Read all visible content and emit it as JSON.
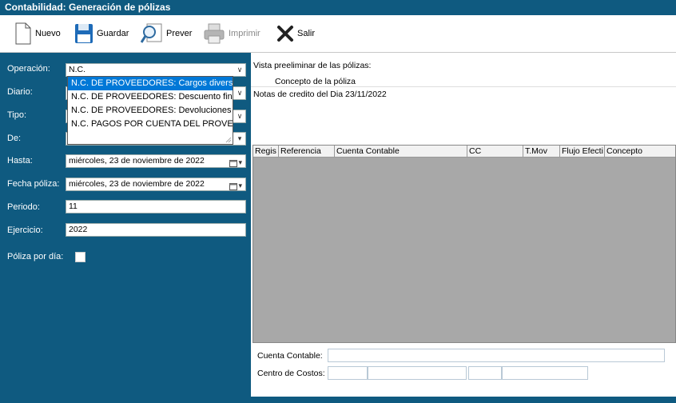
{
  "window": {
    "title": "Contabilidad: Generación de pólizas"
  },
  "toolbar": {
    "nuevo": "Nuevo",
    "guardar": "Guardar",
    "prever": "Prever",
    "imprimir": "Imprimir",
    "salir": "Salir"
  },
  "form": {
    "operacion_label": "Operación:",
    "operacion_value": "N.C.",
    "diario_label": "Diario:",
    "tipo_label": "Tipo:",
    "de_label": "De:",
    "hasta_label": "Hasta:",
    "hasta_value": "miércoles, 23 de noviembre de 2022",
    "fecha_label": "Fecha póliza:",
    "fecha_value": "miércoles, 23 de noviembre de 2022",
    "periodo_label": "Periodo:",
    "periodo_value": "11",
    "ejercicio_label": "Ejercicio:",
    "ejercicio_value": "2022",
    "poliza_dia_label": "Póliza por día:"
  },
  "dropdown": {
    "items": [
      "N.C. DE PROVEEDORES: Cargos diversos",
      "N.C. DE PROVEEDORES: Descuento financi",
      "N.C. DE PROVEEDORES: Devoluciones",
      "N.C. PAGOS POR CUENTA DEL PROVEEDO"
    ],
    "selected_index": 0
  },
  "preview": {
    "title": "Vista preeliminar de las pólizas:",
    "concepto_header": "Concepto de la póliza",
    "concepto_text": "Notas de credito del Dia 23/11/2022"
  },
  "grid": {
    "columns": [
      "Regis",
      "Referencia",
      "Cuenta Contable",
      "CC",
      "T.Mov",
      "Flujo Efecti",
      "Concepto"
    ]
  },
  "bottom": {
    "cuenta_label": "Cuenta Contable:",
    "centro_label": "Centro de Costos:"
  }
}
